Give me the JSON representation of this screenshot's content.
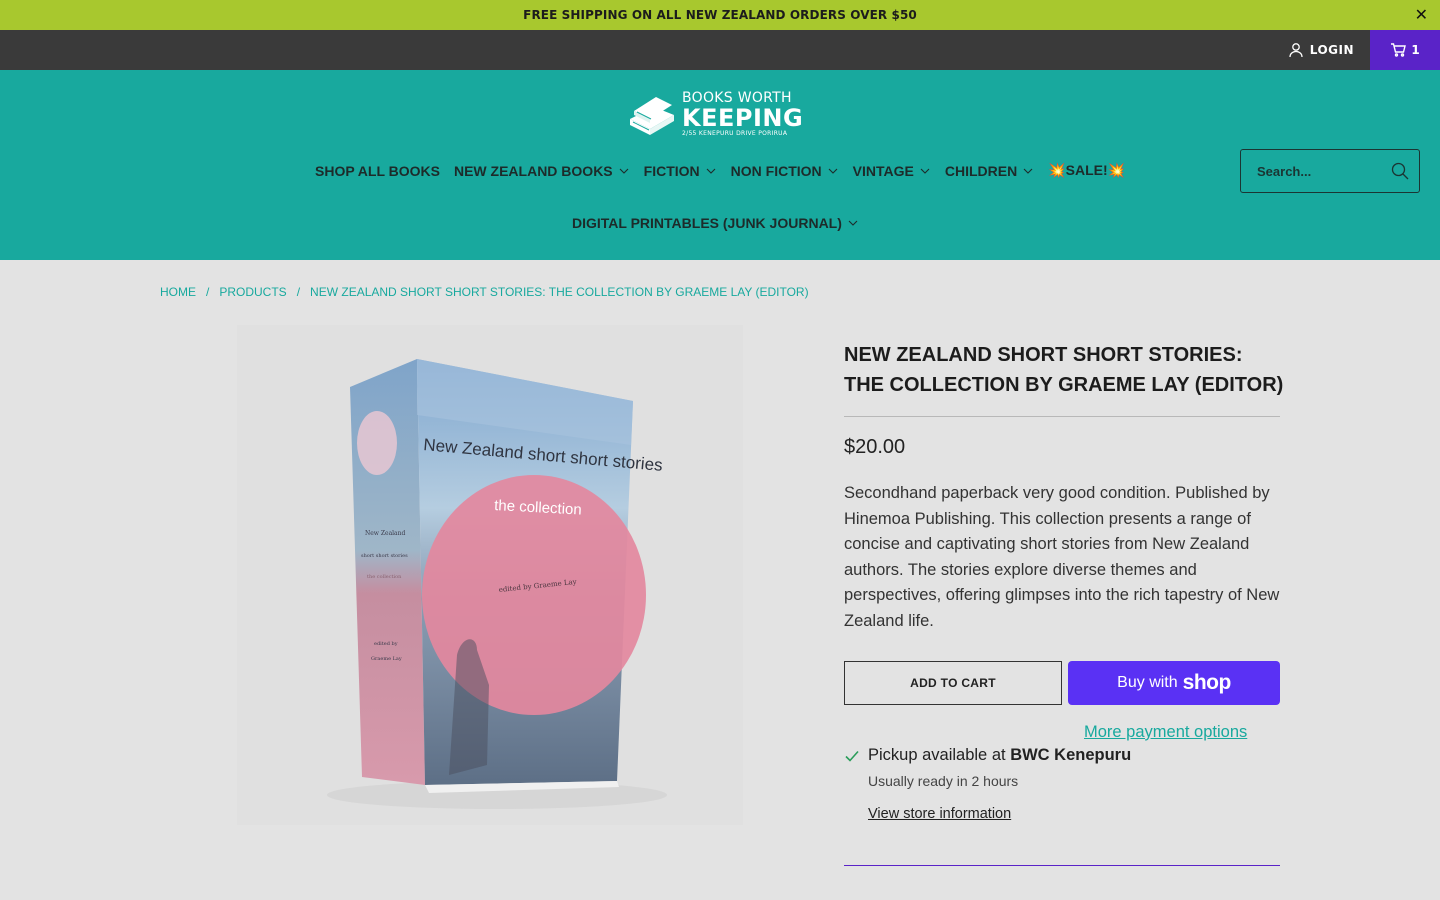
{
  "announcement": {
    "text": "FREE SHIPPING ON ALL NEW ZEALAND ORDERS OVER $50",
    "close_icon": "close-icon"
  },
  "topbar": {
    "login_label": "LOGIN",
    "cart_count": "1"
  },
  "logo": {
    "line1": "BOOKS WORTH",
    "line2": "KEEPING",
    "line3": "2/55 KENEPURU DRIVE PORIRUA"
  },
  "nav": {
    "items": [
      {
        "label": "SHOP ALL BOOKS",
        "has_dropdown": false
      },
      {
        "label": "NEW ZEALAND BOOKS",
        "has_dropdown": true
      },
      {
        "label": "FICTION",
        "has_dropdown": true
      },
      {
        "label": "NON FICTION",
        "has_dropdown": true
      },
      {
        "label": "VINTAGE",
        "has_dropdown": true
      },
      {
        "label": "CHILDREN",
        "has_dropdown": true
      },
      {
        "label": "💥SALE!💥",
        "has_dropdown": false
      }
    ],
    "second_row": {
      "label": "DIGITAL PRINTABLES (JUNK JOURNAL)",
      "has_dropdown": true
    }
  },
  "search": {
    "placeholder": "Search..."
  },
  "breadcrumb": {
    "home": "HOME",
    "products": "PRODUCTS",
    "current": "NEW ZEALAND SHORT SHORT STORIES: THE COLLECTION BY GRAEME LAY (EDITOR)",
    "separator": "/"
  },
  "cover": {
    "title": "New Zealand short short stories",
    "subtitle": "the collection",
    "editor": "edited by Graeme Lay",
    "spine_line1": "New Zealand",
    "spine_line2": "short short stories",
    "spine_line3": "the collection",
    "spine_line4": "edited by",
    "spine_line5": "Graeme Lay"
  },
  "product": {
    "title": "NEW ZEALAND SHORT SHORT STORIES: THE COLLECTION BY GRAEME LAY (EDITOR)",
    "price": "$20.00",
    "description": "Secondhand paperback very good condition. Published by Hinemoa Publishing. This collection presents a range of concise and captivating short stories from New Zealand authors. The stories explore diverse themes and perspectives, offering glimpses into the rich tapestry of New Zealand life.",
    "add_to_cart": "ADD TO CART",
    "buy_with": "Buy with",
    "shop": "shop",
    "more_payment": "More payment options",
    "pickup_prefix": "Pickup available at",
    "pickup_location": "BWC Kenepuru",
    "pickup_time": "Usually ready in 2 hours",
    "store_info": "View store information"
  },
  "colors": {
    "announce_bg": "#a8c82e",
    "topbar_bg": "#3a3a3a",
    "cart_bg": "#5a23c8",
    "header_bg": "#18a99e",
    "page_bg": "#e3e3e3",
    "shop_pay": "#5a31f4",
    "accent": "#18a99e"
  }
}
